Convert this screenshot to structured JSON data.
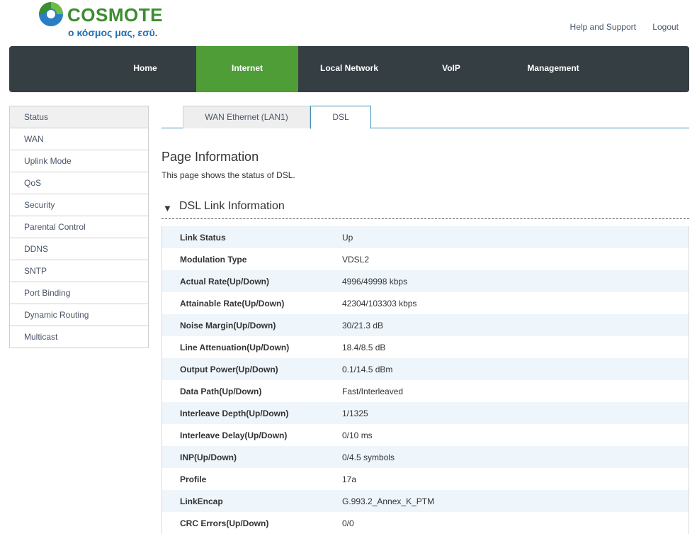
{
  "brand": {
    "name": "COSMOTE",
    "tagline": "ο κόσμος μας, εσύ."
  },
  "top_links": {
    "help": "Help and Support",
    "logout": "Logout"
  },
  "main_nav": [
    {
      "label": "Home"
    },
    {
      "label": "Internet",
      "active": true
    },
    {
      "label": "Local Network"
    },
    {
      "label": "VoIP"
    },
    {
      "label": "Management"
    }
  ],
  "sidebar": {
    "items": [
      {
        "label": "Status",
        "active": true
      },
      {
        "label": "WAN"
      },
      {
        "label": "Uplink Mode"
      },
      {
        "label": "QoS"
      },
      {
        "label": "Security"
      },
      {
        "label": "Parental Control"
      },
      {
        "label": "DDNS"
      },
      {
        "label": "SNTP"
      },
      {
        "label": "Port Binding"
      },
      {
        "label": "Dynamic Routing"
      },
      {
        "label": "Multicast"
      }
    ]
  },
  "tabs": [
    {
      "label": "WAN Ethernet (LAN1)"
    },
    {
      "label": "DSL",
      "active": true
    }
  ],
  "page": {
    "title": "Page Information",
    "description": "This page shows the status of DSL."
  },
  "section": {
    "title": "DSL Link Information"
  },
  "dsl_rows": [
    {
      "key": "Link Status",
      "value": "Up"
    },
    {
      "key": "Modulation Type",
      "value": "VDSL2"
    },
    {
      "key": "Actual Rate(Up/Down)",
      "value": "4996/49998 kbps"
    },
    {
      "key": "Attainable Rate(Up/Down)",
      "value": "42304/103303 kbps"
    },
    {
      "key": "Noise Margin(Up/Down)",
      "value": "30/21.3 dB"
    },
    {
      "key": "Line Attenuation(Up/Down)",
      "value": "18.4/8.5 dB"
    },
    {
      "key": "Output Power(Up/Down)",
      "value": "0.1/14.5 dBm"
    },
    {
      "key": "Data Path(Up/Down)",
      "value": "Fast/Interleaved"
    },
    {
      "key": "Interleave Depth(Up/Down)",
      "value": "1/1325"
    },
    {
      "key": "Interleave Delay(Up/Down)",
      "value": "0/10 ms"
    },
    {
      "key": "INP(Up/Down)",
      "value": "0/4.5 symbols"
    },
    {
      "key": "Profile",
      "value": "17a"
    },
    {
      "key": "LinkEncap",
      "value": "G.993.2_Annex_K_PTM"
    },
    {
      "key": "CRC Errors(Up/Down)",
      "value": "0/0"
    }
  ],
  "colors": {
    "nav_bg": "#353e43",
    "nav_active": "#4e9d37",
    "brand_green": "#3c8d2f",
    "brand_blue": "#1f6fb5",
    "row_alt": "#eef5fb",
    "tab_line": "#3f8fb8"
  }
}
